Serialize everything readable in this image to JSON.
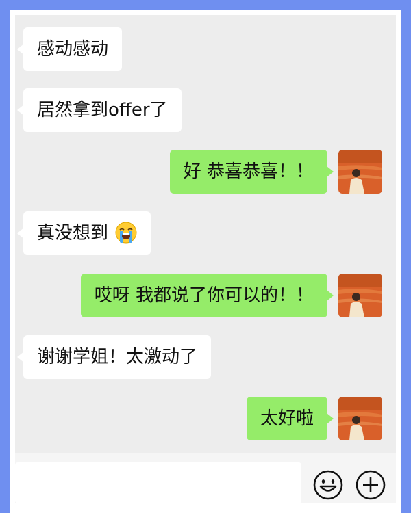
{
  "messages": [
    {
      "side": "left",
      "text": "感动感动"
    },
    {
      "side": "left",
      "text": "居然拿到offer了"
    },
    {
      "side": "right",
      "text": "好 恭喜恭喜！！"
    },
    {
      "side": "left",
      "text": "真没想到",
      "emoji": "loudly-crying-face-icon"
    },
    {
      "side": "right",
      "text": "哎呀 我都说了你可以的！！"
    },
    {
      "side": "left",
      "text": "谢谢学姐！太激动了"
    },
    {
      "side": "right",
      "text": "太好啦"
    }
  ],
  "input": {
    "value": "",
    "placeholder": ""
  },
  "toolbar": {
    "icons": [
      "emoji-icon",
      "plus-icon"
    ]
  },
  "colors": {
    "frame_border": "#6f8ff0",
    "chat_background": "#ededed",
    "left_bubble": "#ffffff",
    "right_bubble": "#95ec69"
  }
}
